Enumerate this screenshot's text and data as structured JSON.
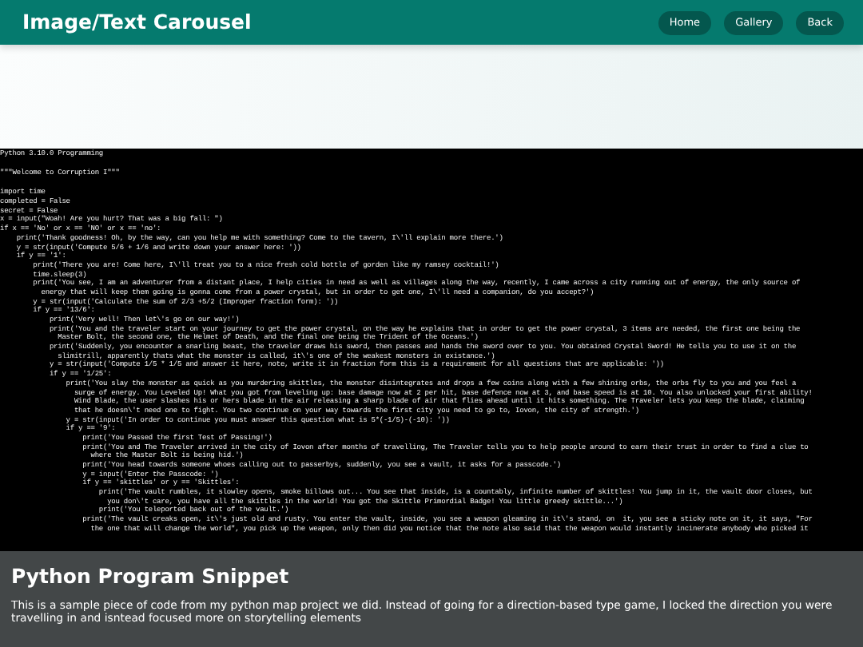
{
  "navbar": {
    "title": "Image/Text Carousel",
    "buttons": [
      "Home",
      "Gallery",
      "Back"
    ]
  },
  "slide": {
    "code_blocks": [
      [
        "Python 3.10.0 Programming"
      ],
      [
        "\"\"\"Welcome to Corruption I\"\"\""
      ],
      [
        "import time",
        "completed = False",
        "secret = False",
        "x = input(\"Woah! Are you hurt? That was a big fall: \")",
        "if x == 'No' or x == 'NO' or x == 'no':",
        "    print('Thank goodness! Oh, by the way, can you help me with something? Come to the tavern, I\\'ll explain more there.')",
        "    y = str(input('Compute 5/6 + 1/6 and write down your answer here: '))",
        "    if y == '1':",
        "        print('There you are! Come here, I\\'ll treat you to a nice fresh cold bottle of gorden like my ramsey cocktail!')",
        "        time.sleep(3)",
        "        print('You see, I am an adventurer from a distant place, I help cities in need as well as villages along the way, recently, I came across a city running out of energy, the only source of",
        "          energy that will keep them going is gonna come from a power crystal, but in order to get one, I\\'ll need a companion, do you accept?')",
        "        y = str(input('Calculate the sum of 2/3 +5/2 (Improper fraction form): '))",
        "        if y == '13/6':",
        "            print('Very well! Then let\\'s go on our way!')",
        "            print('You and the traveler start on your journey to get the power crystal, on the way he explains that in order to get the power crystal, 3 items are needed, the first one being the",
        "              Master Bolt, the second one, the Helmet of Death, and the final one being the Trident of the Oceans.')",
        "            print('Suddenly, you encounter a snarling beast, the traveler draws his sword, then passes and hands the sword over to you. You obtained Crystal Sword! He tells you to use it on the",
        "              slimitrill, apparently thats what the monster is called, it\\'s one of the weakest monsters in existance.')",
        "            y = str(input('Compute 1/5 * 1/5 and answer it here, note, write it in fraction form this is a requirement for all questions that are applicable: '))",
        "            if y == '1/25':",
        "                print('You slay the monster as quick as you murdering skittles, the monster disintegrates and drops a few coins along with a few shining orbs, the orbs fly to you and you feel a",
        "                  surge of energy. You Leveled Up! What you got from leveling up: base damage now at 2 per hit, base defence now at 3, and base speed is at 10. You also unlocked your first ability!",
        "                  Wind Blade, the user slashes his or hers blade in the air releasing a sharp blade of air that flies ahead until it hits something. The Traveler lets you keep the blade, claiming",
        "                  that he doesn\\'t need one to fight. You two continue on your way towards the first city you need to go to, Iovon, the city of strength.')",
        "                y = str(input('In order to continue you must answer this question what is 5*(-1/5)-(-10): '))",
        "                if y == '9':",
        "                    print('You Passed the first Test of Passing!')",
        "                    print('You and The Traveler arrived in the city of Iovon after months of travelling, The Traveler tells you to help people around to earn their trust in order to find a clue to",
        "                      where the Master Bolt is being hid.')",
        "                    print('You head towards someone whoes calling out to passerbys, suddenly, you see a vault, it asks for a passcode.')",
        "                    y = input('Enter the Passcode: ')",
        "                    if y == 'skittles' or y == 'Skittles':",
        "                        print('The vault rumbles, it slowley opens, smoke billows out... You see that inside, is a countably, infinite number of skittles! You jump in it, the vault door closes, but",
        "                          you don\\'t care, you have all the skittles in the world! You got the Skittle Primordial Badge! You little greedy skittle...')",
        "                        print('You teleported back out of the vault.')",
        "                    print('The vault creaks open, it\\'s just old and rusty. You enter the vault, inside, you see a weapon gleaming in it\\'s stand, on  it, you see a sticky note on it, it says, \"For",
        "                      the one that will change the world\", you pick up the weapon, only then did you notice that the note also said that the weapon would instantly incinerate anybody who picked it"
      ]
    ],
    "caption": {
      "title": "Python Program Snippet",
      "text": "This is a sample piece of code from my python map project we did. Instead of going for a direction-based type game, I locked the direction you were travelling in and isntead focused more on storytelling elements"
    }
  }
}
